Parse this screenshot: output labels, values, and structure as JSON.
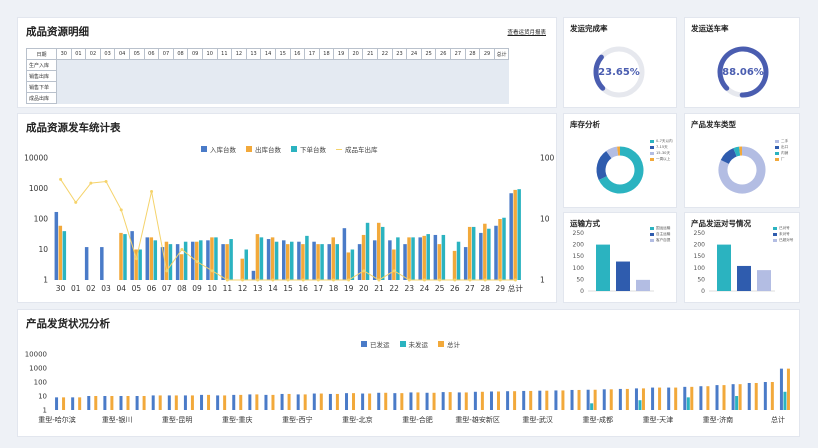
{
  "resource_detail": {
    "title": "成品资源明细",
    "link_label": "查看运货月报表",
    "date_header": "日期",
    "days": [
      "30",
      "01",
      "02",
      "03",
      "04",
      "05",
      "06",
      "07",
      "08",
      "09",
      "10",
      "11",
      "12",
      "13",
      "14",
      "15",
      "16",
      "17",
      "18",
      "19",
      "20",
      "21",
      "22",
      "23",
      "24",
      "25",
      "26",
      "27",
      "28",
      "29",
      "总计"
    ],
    "rows": [
      "生产入库",
      "销售出库",
      "销售下单",
      "成品出库"
    ]
  },
  "gauges": [
    {
      "title": "发运完成率",
      "value_label": "23.65%",
      "value": 0.2365,
      "color": "#4a5db0"
    },
    {
      "title": "发运送车率",
      "value_label": "88.06%",
      "value": 0.8806,
      "color": "#4a5db0"
    }
  ],
  "colors": {
    "blue": "#4a7bc8",
    "orange": "#f2a93b",
    "teal": "#2bb3c0",
    "line": "#f5d36b",
    "navy": "#2f5cae",
    "lavender": "#b3bde3"
  },
  "donuts": [
    {
      "title": "库存分析",
      "legend": [
        "0-7天以内",
        "7-15天",
        "15-30天",
        "一周以上"
      ],
      "values": [
        68,
        22,
        8,
        2
      ],
      "colors": [
        "#2bb3c0",
        "#2f5cae",
        "#b3bde3",
        "#f2a93b"
      ]
    },
    {
      "title": "产品发车类型",
      "legend": [
        "二手",
        "出口",
        "内销",
        "厂"
      ],
      "values": [
        82,
        12,
        4,
        2
      ],
      "colors": [
        "#b3bde3",
        "#2f5cae",
        "#2bb3c0",
        "#f2a93b"
      ]
    }
  ],
  "small_bars": [
    {
      "title": "运输方式",
      "legend": [
        "国运运输",
        "自主运输",
        "客户自提"
      ],
      "yticks": [
        "250",
        "200",
        "150",
        "100",
        "50",
        "0"
      ],
      "ylim": [
        0,
        250
      ],
      "values": [
        200,
        127,
        48
      ],
      "colors": [
        "#2bb3c0",
        "#2f5cae",
        "#b3bde3"
      ]
    },
    {
      "title": "产品发运对号情况",
      "legend": [
        "已对号",
        "未对号",
        "已超对号"
      ],
      "yticks": [
        "250",
        "200",
        "150",
        "100",
        "50",
        "0"
      ],
      "ylim": [
        0,
        250
      ],
      "values": [
        200,
        108,
        90
      ],
      "colors": [
        "#2bb3c0",
        "#2f5cae",
        "#b3bde3"
      ]
    }
  ],
  "chart_data": [
    {
      "type": "bar",
      "title": "成品资源发车统计表",
      "scale": "log",
      "ylim": [
        1,
        10000
      ],
      "y2lim": [
        1,
        10
      ],
      "yticks": [
        "10000",
        "1000",
        "100",
        "10",
        "1"
      ],
      "y2ticks": [
        "100",
        "10",
        "1"
      ],
      "categories": [
        "30",
        "01",
        "02",
        "03",
        "04",
        "05",
        "06",
        "07",
        "08",
        "09",
        "10",
        "11",
        "12",
        "13",
        "14",
        "15",
        "16",
        "17",
        "18",
        "19",
        "20",
        "21",
        "22",
        "23",
        "24",
        "25",
        "26",
        "27",
        "28",
        "29",
        "总计"
      ],
      "legend_position": "top",
      "series": [
        {
          "name": "入库台数",
          "kind": "bar",
          "values": [
            170,
            0,
            12,
            12,
            0,
            40,
            25,
            12,
            15,
            18,
            20,
            15,
            0,
            2,
            22,
            20,
            18,
            18,
            15,
            50,
            15,
            20,
            20,
            15,
            25,
            30,
            0,
            12,
            35,
            60,
            700
          ]
        },
        {
          "name": "出库台数",
          "kind": "bar",
          "values": [
            60,
            0,
            0,
            0,
            35,
            10,
            25,
            18,
            7,
            18,
            25,
            15,
            5,
            32,
            25,
            15,
            15,
            15,
            25,
            8,
            30,
            75,
            10,
            25,
            28,
            15,
            9,
            55,
            70,
            100,
            900
          ]
        },
        {
          "name": "下单台数",
          "kind": "bar",
          "values": [
            40,
            0,
            0,
            0,
            32,
            10,
            20,
            15,
            18,
            20,
            25,
            22,
            10,
            25,
            18,
            18,
            28,
            15,
            15,
            10,
            75,
            55,
            25,
            25,
            32,
            30,
            18,
            55,
            48,
            110,
            950
          ]
        },
        {
          "name": "成品车出库",
          "kind": "line",
          "values": [
            2000,
            350,
            1500,
            1700,
            200,
            5,
            800,
            2,
            10,
            4,
            2,
            1,
            1,
            1,
            1,
            1,
            1,
            1,
            1,
            1,
            2,
            1,
            2,
            1,
            1,
            1,
            1,
            1,
            1,
            1,
            1
          ]
        }
      ]
    },
    {
      "type": "bar",
      "title": "产品发货状况分析",
      "scale": "log",
      "ylim": [
        1,
        10000
      ],
      "yticks": [
        "10000",
        "1000",
        "100",
        "10",
        "1"
      ],
      "xlabels": [
        "重型-哈尔滨",
        "重型-银川",
        "重型-昆明",
        "重型-重庆",
        "重型-西宁",
        "重型-北京",
        "重型-合肥",
        "重型-雄安新区",
        "重型-武汉",
        "重型-成都",
        "重型-天津",
        "重型-济南",
        "总计"
      ],
      "legend_position": "top",
      "series": [
        {
          "name": "已发运",
          "values": [
            8,
            8,
            10,
            10,
            10,
            10,
            11,
            11,
            11,
            12,
            11,
            12,
            13,
            12,
            14,
            13,
            15,
            14,
            16,
            15,
            17,
            16,
            18,
            17,
            19,
            18,
            20,
            21,
            22,
            23,
            24,
            25,
            27,
            28,
            30,
            32,
            35,
            40,
            40,
            45,
            50,
            60,
            70,
            85,
            100,
            900
          ]
        },
        {
          "name": "未发运",
          "values": [
            0,
            0,
            0,
            0,
            0,
            0,
            0,
            0,
            0,
            0,
            0,
            0,
            0,
            0,
            0,
            0,
            0,
            0,
            0,
            0,
            0,
            0,
            0,
            0,
            0,
            0,
            0,
            0,
            0,
            0,
            0,
            0,
            0,
            3,
            0,
            0,
            5,
            0,
            0,
            8,
            0,
            0,
            10,
            0,
            0,
            20
          ]
        },
        {
          "name": "总计",
          "values": [
            8,
            8,
            10,
            10,
            10,
            10,
            11,
            11,
            11,
            12,
            11,
            12,
            13,
            12,
            14,
            13,
            15,
            14,
            16,
            15,
            17,
            16,
            18,
            17,
            19,
            18,
            20,
            21,
            22,
            23,
            24,
            25,
            27,
            28,
            30,
            32,
            35,
            40,
            40,
            45,
            50,
            60,
            70,
            85,
            100,
            900
          ]
        }
      ]
    }
  ]
}
